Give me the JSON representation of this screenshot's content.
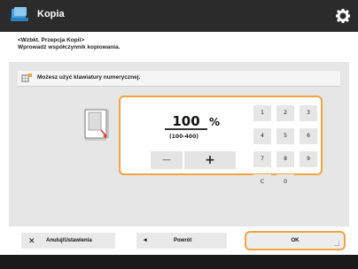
{
  "window": {
    "title": "Kopia"
  },
  "breadcrumb": {
    "line1": "<Wzbkt. Przepcja Kopii>",
    "line2": "Wprowadź współczynnik kopiowania."
  },
  "notice": {
    "text": "Możesz użyć klawiatury numerycznej."
  },
  "zoom": {
    "value": "100",
    "unit": "%",
    "range": "(100-400)",
    "minus_label": "−",
    "plus_label": "+"
  },
  "keypad": {
    "keys": [
      "1",
      "2",
      "3",
      "4",
      "5",
      "6",
      "7",
      "8",
      "9",
      "C",
      "0"
    ]
  },
  "buttons": {
    "reset_label": "Anuluj/Ustawienia",
    "back_label": "Powrót",
    "ok_label": "OK"
  },
  "colors": {
    "accent": "#f0a640",
    "titlebar": "#2b2b2b",
    "panel": "#e6e6e6"
  },
  "icons": {
    "app": "copier-icon",
    "settings": "gear-icon",
    "notice": "keypad-hint-icon"
  }
}
